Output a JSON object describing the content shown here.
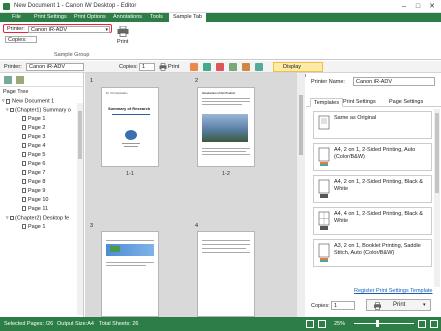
{
  "window": {
    "title": "New Document 1 - Canon iW Desktop - Editor",
    "minimize": "–",
    "maximize": "□",
    "close": "✕"
  },
  "ribbon_tabs": [
    "File",
    "Print Settings",
    "Print Options",
    "Annotations",
    "Tools",
    "Sample Tab"
  ],
  "ribbon": {
    "printer_label": "Printer:",
    "printer_value": "Canon iR-ADV",
    "copies_value": "Copies:",
    "group_label": "Sample Group",
    "print_label": "Print"
  },
  "toolbar": {
    "printer_label": "Printer:",
    "printer_value": "Canon iR-ADV",
    "copies_label": "Copies:",
    "copies_value": "1",
    "print_label": "Print",
    "display_annotations": "Display Annotations"
  },
  "left_pane": {
    "title": "Page Tree",
    "document": "New Document 1",
    "chapter1": "(Chapter1) Summary o",
    "chapter2": "(Chapter2) Desktop fe",
    "pages": [
      "Page 1",
      "Page 2",
      "Page 3",
      "Page 4",
      "Page 5",
      "Page 6",
      "Page 7",
      "Page 8",
      "Page 9",
      "Page 10",
      "Page 11"
    ],
    "chapter2_pages": [
      "Page 1"
    ]
  },
  "center": {
    "sheet_numbers": [
      "1",
      "2",
      "3",
      "4"
    ],
    "page_captions": [
      "1-1",
      "1-2"
    ],
    "page1_title": "Summary of Research",
    "page1_header": "Fri. XX Corporation",
    "page2_title": "Introduction of Xxx Product"
  },
  "right_pane": {
    "printer_label": "Printer Name:",
    "printer_value": "Canon iR-ADV",
    "tabs": [
      "Templates",
      "Print Settings",
      "Page Settings"
    ],
    "templates": [
      "Same as Original",
      "A4, 2 on 1, 2-Sided Printing, Auto (Color/B&W)",
      "A4, 2 on 1, 2-Sided Printing, Black & White",
      "A4, 4 on 1, 2-Sided Printing, Black & White",
      "A3, 2 on 1, Booklet Printing, Saddle Stitch, Auto (Color/B&W)"
    ],
    "register_link": "Register Print Settings Template",
    "copies_label": "Copies:",
    "copies_value": "1",
    "print_label": "Print"
  },
  "status": {
    "selected_pages": "Selected Pages: /26",
    "output_size": "Output Size:A4",
    "total_sheets": "Total Sheets: 26",
    "zoom": "25%"
  },
  "colors": {
    "accent_green": "#2d7d46",
    "highlight_red": "#e23333",
    "annotation_yellow": "#fde9a8",
    "link_blue": "#1a5fb4"
  }
}
